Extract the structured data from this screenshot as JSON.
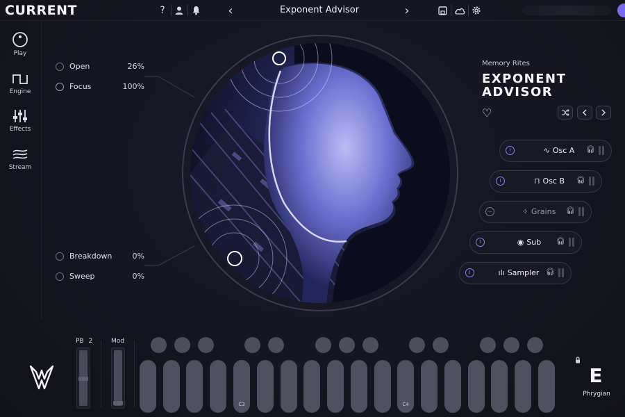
{
  "app": {
    "brand": "CURRENT"
  },
  "topbar": {
    "help_icon": "?",
    "preset_name": "Exponent Advisor",
    "prev_icon": "‹",
    "next_icon": "›"
  },
  "nav": [
    {
      "label": "Play",
      "icon": "play-knob-icon"
    },
    {
      "label": "Engine",
      "icon": "square-wave-icon"
    },
    {
      "label": "Effects",
      "icon": "sliders-icon"
    },
    {
      "label": "Stream",
      "icon": "waves-icon"
    }
  ],
  "macros": {
    "open": {
      "label": "Open",
      "value": "26%"
    },
    "focus": {
      "label": "Focus",
      "value": "100%"
    },
    "breakdown": {
      "label": "Breakdown",
      "value": "0%"
    },
    "sweep": {
      "label": "Sweep",
      "value": "0%"
    }
  },
  "preset": {
    "pack": "Memory Rites",
    "title_line1": "EXPONENT",
    "title_line2": "ADVISOR"
  },
  "layers": [
    {
      "name": "Osc A",
      "icon": "∿",
      "enabled": true
    },
    {
      "name": "Osc B",
      "icon": "⊓",
      "enabled": true
    },
    {
      "name": "Grains",
      "icon": "⁘",
      "enabled": false
    },
    {
      "name": "Sub",
      "icon": "◉",
      "enabled": true
    },
    {
      "name": "Sampler",
      "icon": "ılı",
      "enabled": true
    }
  ],
  "wheels": {
    "pb_label": "PB",
    "pb_range": "2",
    "mod_label": "Mod"
  },
  "keyboard": {
    "labels": {
      "c3": "C3",
      "c4": "C4"
    }
  },
  "key": {
    "note": "E",
    "scale": "Phrygian"
  },
  "colors": {
    "accent": "#8d82ee",
    "background": "#15151f",
    "key": "#4f4f5d"
  }
}
